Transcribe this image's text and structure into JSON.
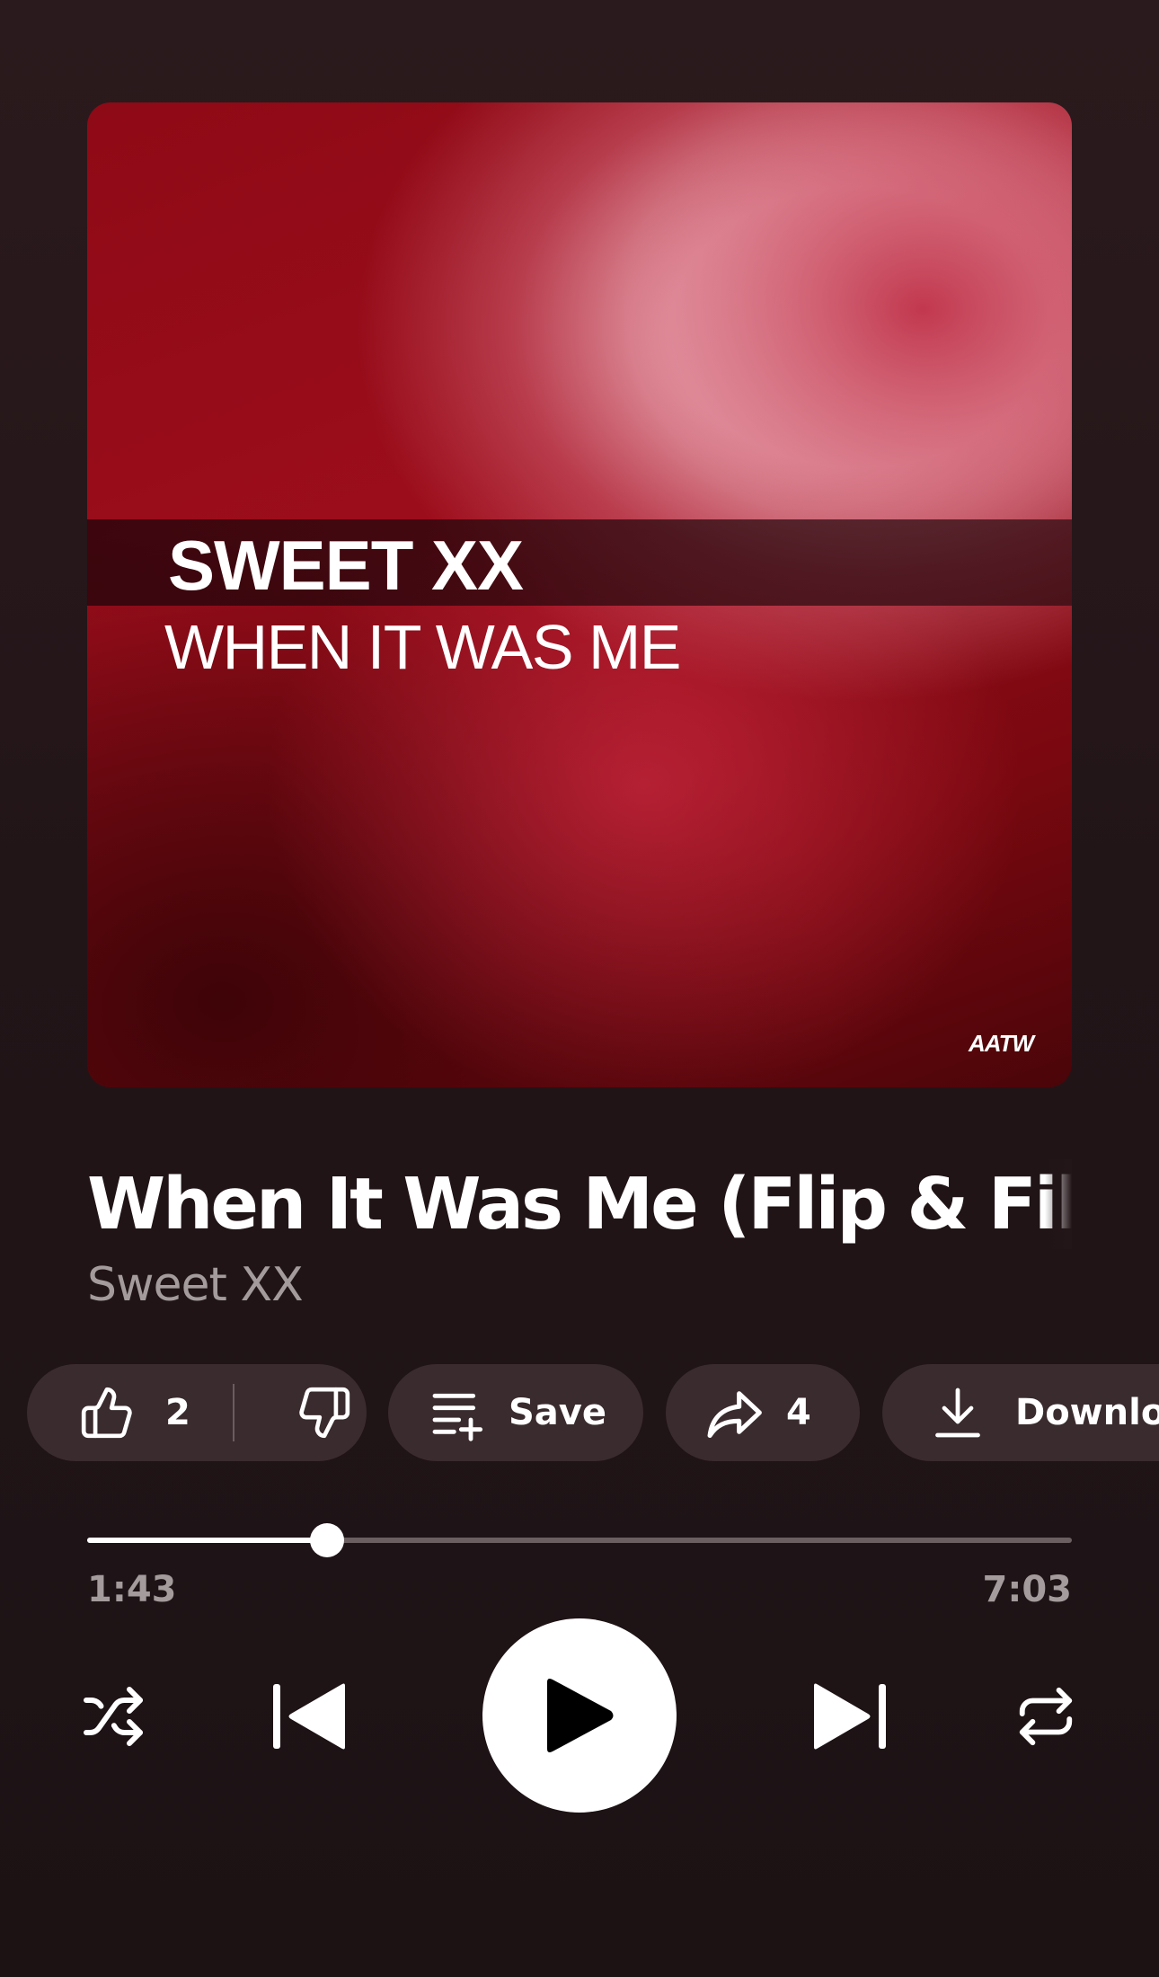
{
  "album_art": {
    "artist_text": "SWEET XX",
    "title_text": "WHEN IT WAS ME",
    "label_logo": "AATW"
  },
  "track": {
    "title": "When It Was Me (Flip & Fill",
    "artist": "Sweet XX"
  },
  "actions": {
    "like": {
      "icon": "thumbs-up-icon",
      "count": "2"
    },
    "dislike": {
      "icon": "thumbs-down-icon"
    },
    "save": {
      "icon": "playlist-add-icon",
      "label": "Save"
    },
    "share": {
      "icon": "share-arrow-icon",
      "count": "4"
    },
    "download": {
      "icon": "download-icon",
      "label": "Download"
    }
  },
  "playback": {
    "current_time": "1:43",
    "total_time": "7:03",
    "progress_fraction": 0.244,
    "state": "paused"
  },
  "controls": {
    "shuffle": "shuffle-icon",
    "previous": "skip-previous-icon",
    "play": "play-icon",
    "next": "skip-next-icon",
    "repeat": "repeat-icon"
  },
  "colors": {
    "background": "#221518",
    "pill_background": "#3a2b2e",
    "secondary_text": "#a39b9c",
    "progress_track": "#6b5f61",
    "accent": "#ffffff"
  }
}
